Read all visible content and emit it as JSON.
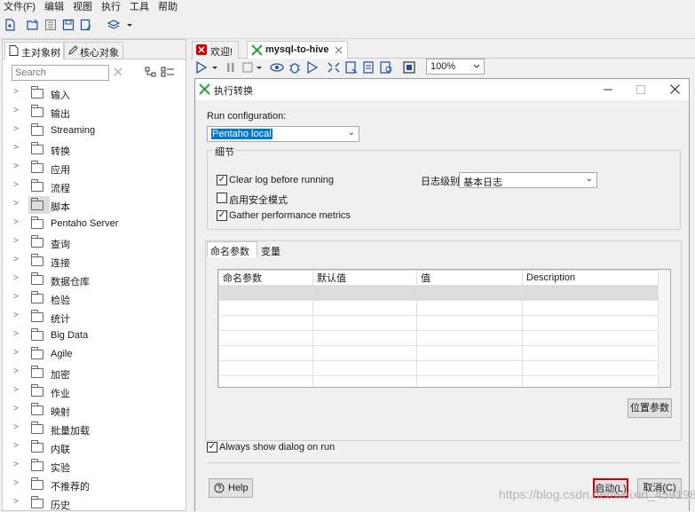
{
  "menubar": {
    "items": [
      "文件(F)",
      "编辑",
      "视图",
      "执行",
      "工具",
      "帮助"
    ]
  },
  "left_panel": {
    "tabs": [
      "主对象树",
      "核心对象"
    ],
    "search_placeholder": "Search",
    "tree_items": [
      "输入",
      "输出",
      "Streaming",
      "转换",
      "应用",
      "流程",
      "脚本",
      "Pentaho Server",
      "查询",
      "连接",
      "数据仓库",
      "检验",
      "统计",
      "Big Data",
      "Agile",
      "加密",
      "作业",
      "映射",
      "批量加载",
      "内联",
      "实验",
      "不推荐的",
      "历史"
    ],
    "selected_item": "脚本"
  },
  "editor_tabs": [
    "欢迎!",
    "mysql-to-hive"
  ],
  "zoom": "100%",
  "dialog": {
    "title": "执行转换",
    "run_configuration_label": "Run configuration:",
    "run_configuration_value": "Pentaho local",
    "details_group": "细节",
    "clear_log": "Clear log before running",
    "safe_mode": "启用安全模式",
    "gather_metrics": "Gather performance metrics",
    "log_level_label": "日志级别",
    "log_level_value": "基本日志",
    "params_tabs": [
      "命名参数",
      "变量"
    ],
    "params_columns": [
      "命名参数",
      "默认值",
      "值",
      "Description"
    ],
    "position_params_button": "位置参数",
    "always_show": "Always show dialog on run",
    "help_button": "Help",
    "launch_button": "启动(L)",
    "cancel_button": "取消(C)"
  },
  "watermark": "https://blog.csdn.net/weixin_45919810",
  "colors": {
    "accent_red": "#cc0000",
    "selection_blue": "#0078d7",
    "icon_blue": "#1f4e9c",
    "icon_green": "#2e9c3a"
  }
}
